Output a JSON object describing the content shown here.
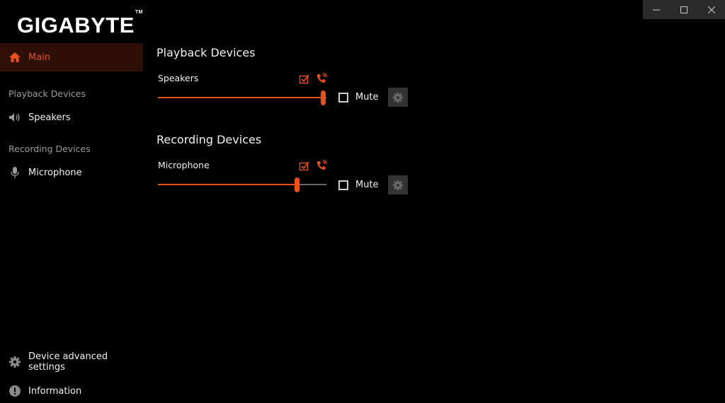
{
  "window": {
    "minimize_icon": "minimize-icon",
    "maximize_icon": "maximize-icon",
    "close_icon": "close-icon"
  },
  "brand": {
    "logo": "GIGABYTE",
    "tm": "TM"
  },
  "sidebar": {
    "main": {
      "label": "Main",
      "icon": "home-icon",
      "selected": true
    },
    "playback_header": "Playback Devices",
    "speakers": {
      "label": "Speakers",
      "icon": "speaker-icon"
    },
    "recording_header": "Recording Devices",
    "microphone": {
      "label": "Microphone",
      "icon": "microphone-icon"
    },
    "advanced": {
      "label": "Device advanced settings",
      "icon": "gear-icon"
    },
    "information": {
      "label": "Information",
      "icon": "info-icon"
    }
  },
  "playback": {
    "title": "Playback Devices",
    "device": {
      "name": "Speakers",
      "volume_percent": 100,
      "default_device_icon": "check-box-icon",
      "default_comm_icon": "phone-icon",
      "mute_label": "Mute",
      "muted": false
    }
  },
  "recording": {
    "title": "Recording Devices",
    "device": {
      "name": "Microphone",
      "volume_percent": 84,
      "default_device_icon": "check-box-icon",
      "default_comm_icon": "phone-icon",
      "mute_label": "Mute",
      "muted": false
    }
  },
  "colors": {
    "accent": "#e8501c",
    "selected_bg": "#2e1006",
    "background": "#000000"
  }
}
